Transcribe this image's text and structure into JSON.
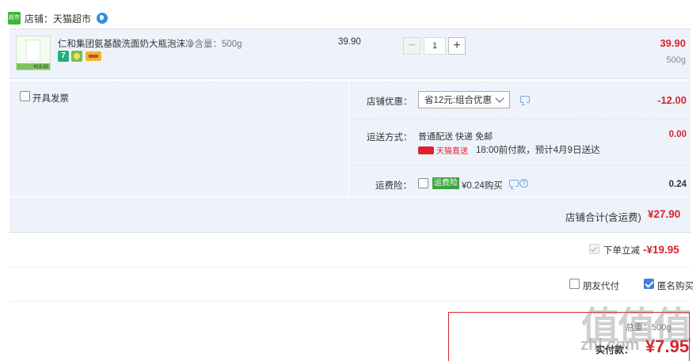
{
  "store": {
    "logo_text": "超市",
    "label": "店铺：天猫超市"
  },
  "item": {
    "title": "仁和集团氨基酸洗面奶大瓶泡沫...",
    "spec": "净含量：500g",
    "badge_7": "7",
    "thumb_price": "¥19.95",
    "unit_price": "39.90",
    "qty_minus": "−",
    "quantity": "1",
    "qty_plus": "+",
    "total": "39.90",
    "weight": "500g"
  },
  "invoice": {
    "label": "开具发票"
  },
  "discount": {
    "label": "店铺优惠：",
    "selected": "省12元:组合优惠",
    "amount": "-12.00"
  },
  "shipping": {
    "label": "运送方式：",
    "method": "普通配送 快递 免邮",
    "tmall_tag": "天猫直送",
    "eta": "18:00前付款，预计4月9日送达",
    "amount": "0.00"
  },
  "insurance": {
    "label": "运费险：",
    "tag": "运费险",
    "text": "¥0.24购买",
    "help": "?",
    "amount": "0.24"
  },
  "subtotal": {
    "label": "店铺合计(含运费)",
    "amount": "¥27.90"
  },
  "instant_discount": {
    "label": "下单立减",
    "amount": "-¥19.95"
  },
  "options": {
    "friend_pay": "朋友代付",
    "anonymous": "匿名购买"
  },
  "summary": {
    "weight_text": "总重：500g",
    "label": "实付款：",
    "amount": "¥7.95"
  },
  "watermark": {
    "big": "值值值",
    "small": "zhi.com"
  },
  "colors": {
    "price_red": "#d8232a",
    "panel_bg": "#eef3fb",
    "tmall_green": "#3cb539",
    "check_blue": "#3d7fdc"
  }
}
